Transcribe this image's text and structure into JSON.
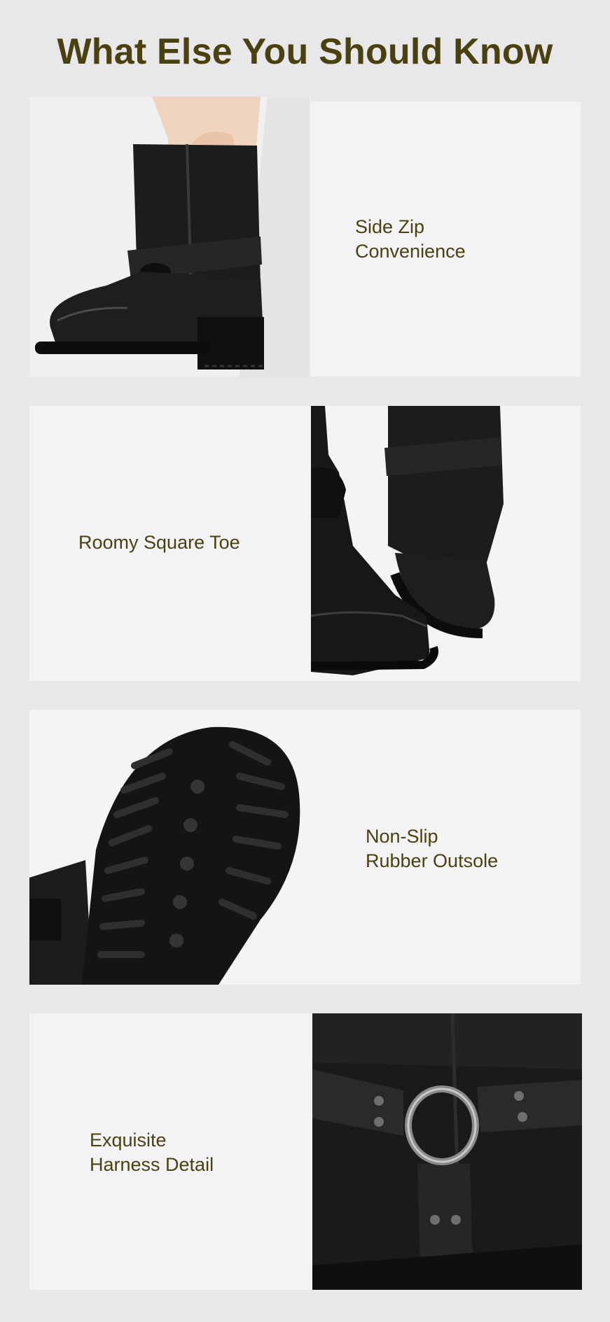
{
  "page": {
    "title": "What Else You Should Know"
  },
  "features": [
    {
      "label_lines": [
        "Side Zip",
        "Convenience"
      ],
      "image_icon": "boot-side-zip-photo-icon"
    },
    {
      "label_lines": [
        "Roomy Square Toe"
      ],
      "image_icon": "square-toe-boots-photo-icon"
    },
    {
      "label_lines": [
        "Non-Slip",
        "Rubber Outsole"
      ],
      "image_icon": "rubber-outsole-photo-icon"
    },
    {
      "label_lines": [
        "Exquisite",
        "Harness Detail"
      ],
      "image_icon": "harness-detail-photo-icon"
    }
  ],
  "colors": {
    "background": "#e8e8ea",
    "panel": "#f3f3f5",
    "text": "#4b400f",
    "leather": "#1a1a1a"
  }
}
